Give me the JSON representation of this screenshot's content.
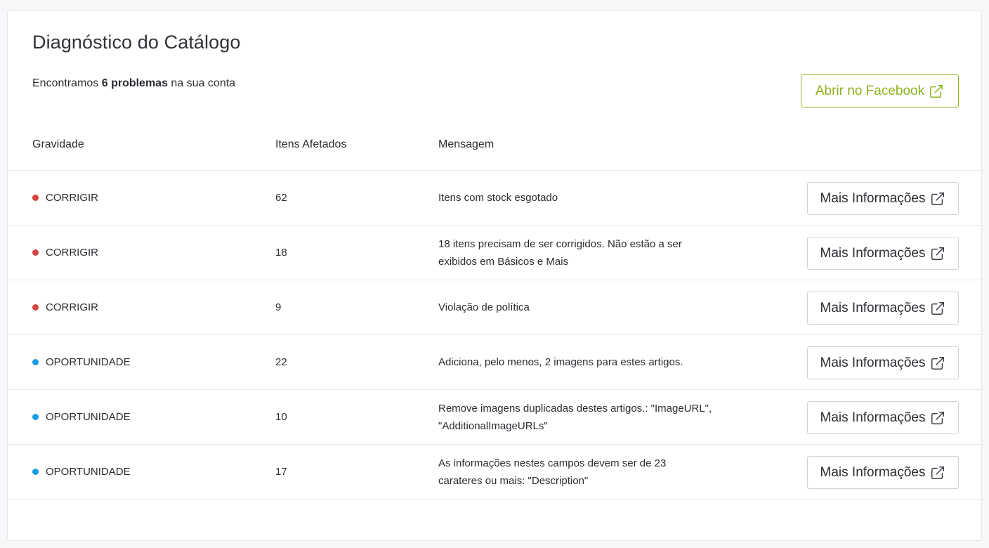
{
  "page": {
    "title": "Diagnóstico do Catálogo",
    "summary_prefix": "Encontramos ",
    "summary_count": "6 problemas",
    "summary_suffix": " na sua conta",
    "open_facebook_label": "Abrir no Facebook"
  },
  "table": {
    "headers": {
      "severity": "Gravidade",
      "affected_items": "Itens Afetados",
      "message": "Mensagem"
    },
    "button_label": "Mais Informações",
    "rows": [
      {
        "severity": "CORRIGIR",
        "severity_color": "#d9443f",
        "affected": "62",
        "message": "Itens com stock esgotado"
      },
      {
        "severity": "CORRIGIR",
        "severity_color": "#d9443f",
        "affected": "18",
        "message": "18 itens precisam de ser corrigidos. Não estão a ser exibidos em Básicos e Mais"
      },
      {
        "severity": "CORRIGIR",
        "severity_color": "#d9443f",
        "affected": "9",
        "message": "Violação de política"
      },
      {
        "severity": "OPORTUNIDADE",
        "severity_color": "#1a9be6",
        "affected": "22",
        "message": "Adiciona, pelo menos, 2 imagens para estes artigos."
      },
      {
        "severity": "OPORTUNIDADE",
        "severity_color": "#1a9be6",
        "affected": "10",
        "message": "Remove imagens duplicadas destes artigos.: \"ImageURL\", \"AdditionalImageURLs\""
      },
      {
        "severity": "OPORTUNIDADE",
        "severity_color": "#1a9be6",
        "affected": "17",
        "message": "As informações nestes campos devem ser de 23 carateres ou mais: \"Description\""
      }
    ]
  },
  "icons": {
    "external_link": "external-link-icon"
  },
  "colors": {
    "accent_green": "#8bb51f",
    "fix_red": "#d9443f",
    "opportunity_blue": "#1a9be6"
  }
}
